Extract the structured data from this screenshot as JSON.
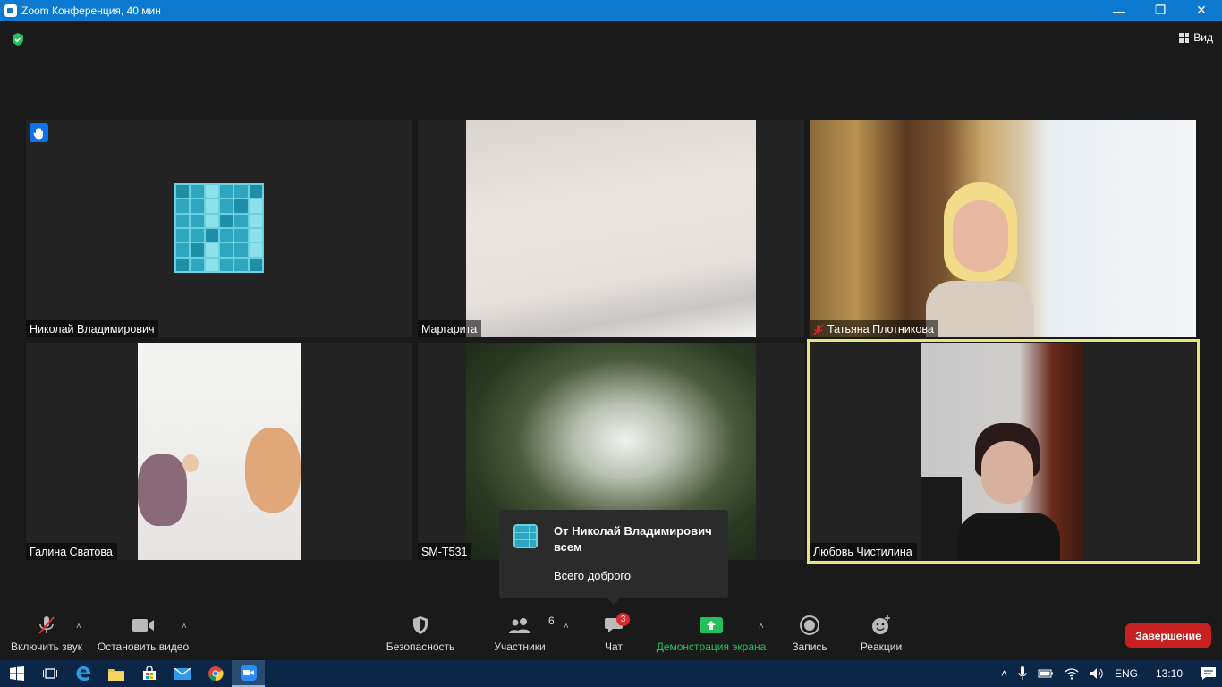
{
  "window": {
    "title": "Zoom Конференция, 40 мин",
    "minimize": "—",
    "restore": "❐",
    "close": "✕"
  },
  "header": {
    "view_label": "Вид"
  },
  "participants": [
    {
      "name": "Николай Владимирович",
      "raised_hand": true
    },
    {
      "name": "Маргарита"
    },
    {
      "name": "Татьяна Плотникова",
      "muted": true
    },
    {
      "name": "Галина Сватова"
    },
    {
      "name": "SM-T531"
    },
    {
      "name": "Любовь Чистилина",
      "active_speaker": true
    }
  ],
  "chat_popup": {
    "from": "От Николай Владимирович всем",
    "message": "Всего доброго"
  },
  "toolbar": {
    "audio_label": "Включить звук",
    "video_label": "Остановить видео",
    "security_label": "Безопасность",
    "participants_label": "Участники",
    "participants_count": "6",
    "chat_label": "Чат",
    "chat_badge": "3",
    "share_label": "Демонстрация экрана",
    "record_label": "Запись",
    "reactions_label": "Реакции",
    "end_label": "Завершение"
  },
  "taskbar": {
    "language": "ENG",
    "time": "13:10"
  },
  "colors": {
    "titlebar": "#0b79d0",
    "share_green": "#23c15a",
    "end_red": "#c82020",
    "active_border": "#e4e57c"
  }
}
